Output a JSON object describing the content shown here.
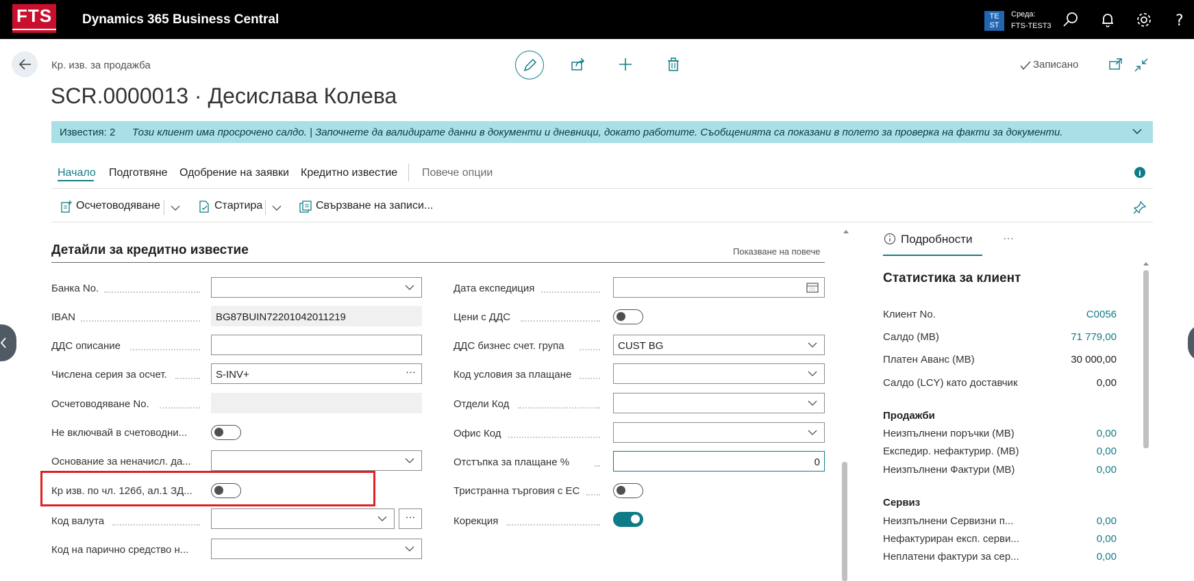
{
  "topbar": {
    "logo_text": "FTS",
    "app_title": "Dynamics 365 Business Central",
    "env_badge": "TE ST",
    "env_label": "Среда:",
    "env_name": "FTS-TEST3",
    "icons": [
      "search-icon",
      "bell-icon",
      "gear-icon",
      "help-icon"
    ]
  },
  "page": {
    "breadcrumb": "Кр. изв. за продажба",
    "title": "SCR.0000013 · Десислава Колева",
    "saved_status": "Записано"
  },
  "notification": {
    "count": "Известия: 2",
    "message": "Този клиент има просрочено салдо.  |  Започнете да валидирате данни в документи и дневници, докато работите. Съобщенията са показани в полето за проверка на факти за документи."
  },
  "tabs": [
    "Начало",
    "Подготвяне",
    "Одобрение на заявки",
    "Кредитно известие"
  ],
  "more_options": "Повече опции",
  "toolbar": {
    "post": "Осчетоводяване",
    "reverse": "Стартира",
    "apply": "Свързване на записи..."
  },
  "section": {
    "title": "Детайли за кредитно известие",
    "show_more": "Показване на повече"
  },
  "left_fields": {
    "bank_no": {
      "label": "Банка No.",
      "value": ""
    },
    "iban": {
      "label": "IBAN",
      "value": "BG87BUIN72201042011219"
    },
    "vat_desc": {
      "label": "ДДС описание",
      "value": ""
    },
    "posting_series": {
      "label": "Числена серия за осчет.",
      "value": "S-INV+"
    },
    "posting_no": {
      "label": "Осчетоводяване No.",
      "value": ""
    },
    "exclude": {
      "label": "Не включвай в счетоводни...",
      "checked": false
    },
    "non_charge": {
      "label": "Основание за неначисл. да...",
      "value": ""
    },
    "art126": {
      "label": "Кр изв. по чл. 126б, ал.1 ЗД...",
      "checked": false
    },
    "currency": {
      "label": "Код валута",
      "value": ""
    },
    "cash_code": {
      "label": "Код на парично средство н...",
      "value": ""
    }
  },
  "right_fields": {
    "ship_date": {
      "label": "Дата експедиция",
      "value": ""
    },
    "prices_vat": {
      "label": "Цени с ДДС",
      "checked": false
    },
    "vat_group": {
      "label": "ДДС бизнес счет. група",
      "value": "CUST BG"
    },
    "pay_terms": {
      "label": "Код условия за плащане",
      "value": ""
    },
    "dept": {
      "label": "Отдели Код",
      "value": ""
    },
    "office": {
      "label": "Офис Код",
      "value": ""
    },
    "pay_discount": {
      "label": "Отстъпка за плащане %",
      "value": "0"
    },
    "eu_trade": {
      "label": "Тристранна търговия с ЕС",
      "checked": false
    },
    "correction": {
      "label": "Корекция",
      "checked": true
    }
  },
  "factbox": {
    "tab": "Подробности",
    "more": "···",
    "title": "Статистика за клиент",
    "rows": [
      {
        "label": "Клиент No.",
        "value": "C0056",
        "link": true
      },
      {
        "label": "Салдо (МВ)",
        "value": "71 779,00",
        "link": true
      },
      {
        "label": "Платен Аванс (МВ)",
        "value": "30 000,00",
        "link": false
      },
      {
        "label": "Салдо (LCY) като доставчик",
        "value": "0,00",
        "link": false
      }
    ],
    "sales_title": "Продажби",
    "sales": [
      {
        "label": "Неизпълнени поръчки (МВ)",
        "value": "0,00"
      },
      {
        "label": "Експедир. нефактурир. (МВ)",
        "value": "0,00"
      },
      {
        "label": "Неизпълнени Фактури (МВ)",
        "value": "0,00"
      }
    ],
    "service_title": "Сервиз",
    "service": [
      {
        "label": "Неизпълнени Сервизни п...",
        "value": "0,00"
      },
      {
        "label": "Нефактуриран експ. серви...",
        "value": "0,00"
      },
      {
        "label": "Неплатени фактури за сер...",
        "value": "0,00"
      }
    ]
  },
  "colors": {
    "accent": "#0e7c86",
    "notification_bg": "#a8e0e6",
    "brand_red": "#c8102e",
    "highlight_red": "#e02020"
  }
}
